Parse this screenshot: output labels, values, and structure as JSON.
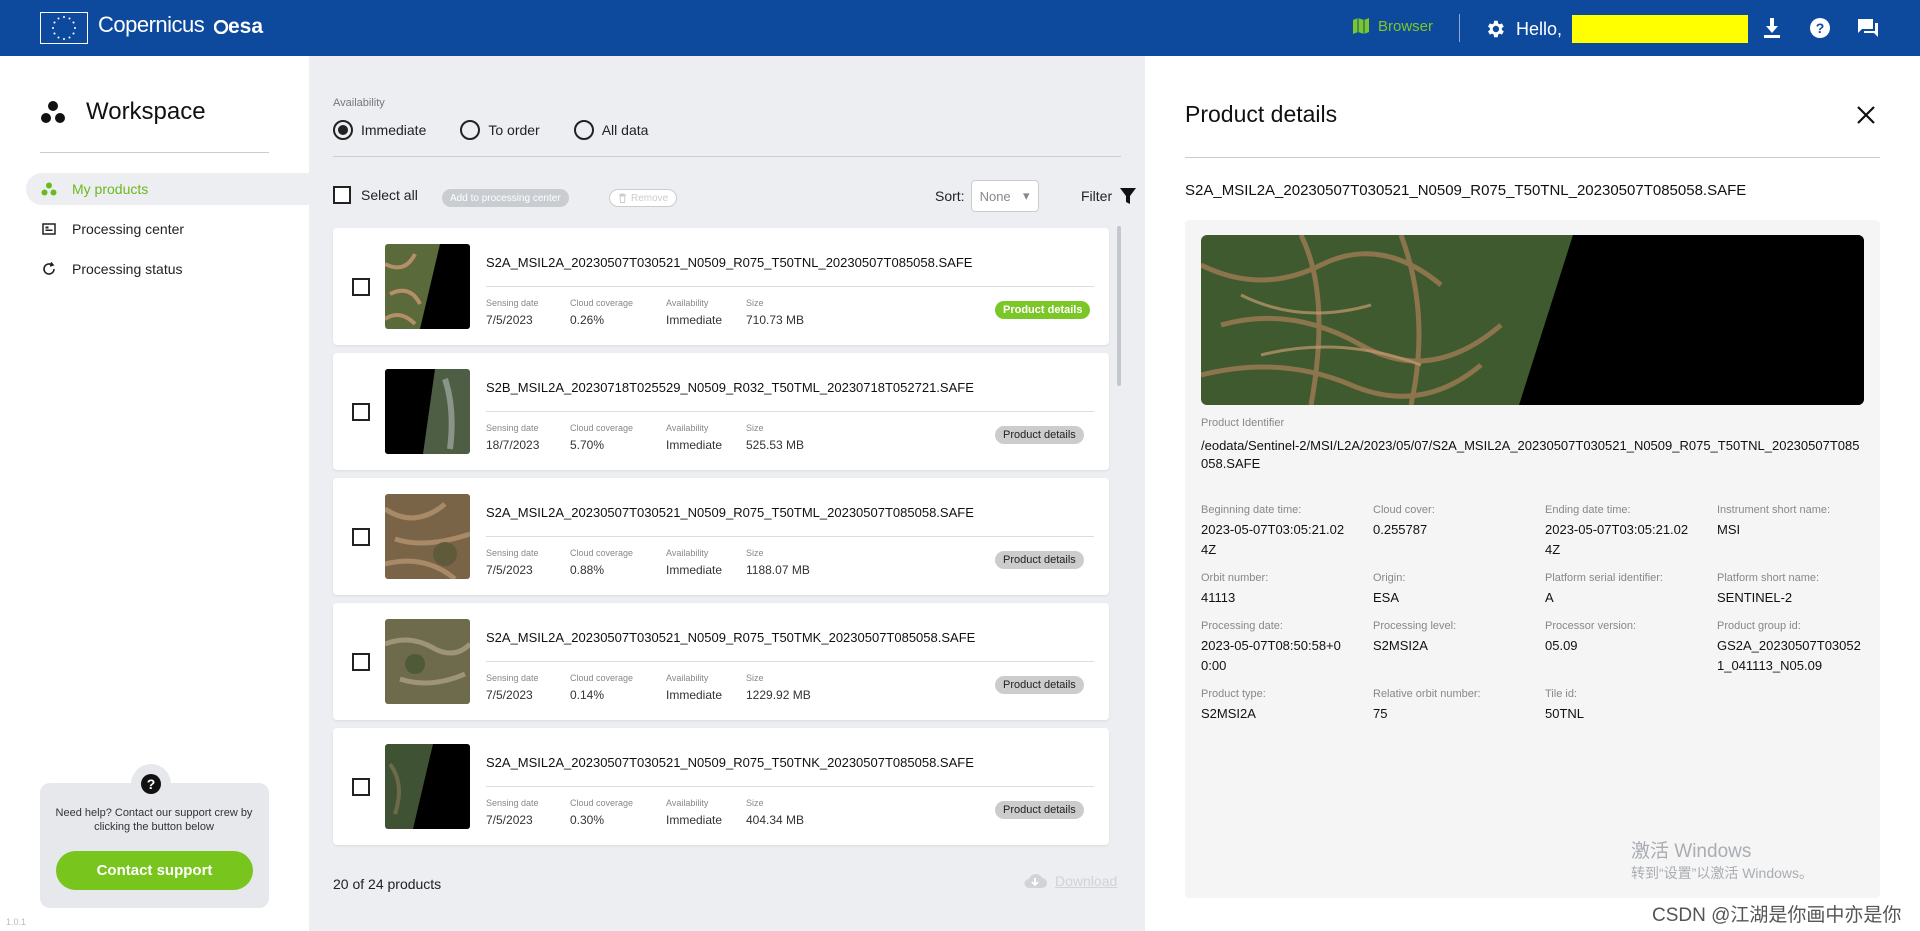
{
  "header": {
    "brand": "Copernicus",
    "agency": "esa",
    "browser_label": "Browser",
    "greeting": "Hello,",
    "icons": [
      "settings-icon",
      "download-icon",
      "help-icon",
      "chat-icon"
    ]
  },
  "sidebar": {
    "title": "Workspace",
    "items": [
      {
        "label": "My products",
        "active": true
      },
      {
        "label": "Processing center",
        "active": false
      },
      {
        "label": "Processing status",
        "active": false
      }
    ],
    "help_text": "Need help? Contact our support crew by clicking the button below",
    "contact_label": "Contact support",
    "version": "1.0.1"
  },
  "main": {
    "availability_label": "Availability",
    "radios": [
      {
        "label": "Immediate",
        "selected": true
      },
      {
        "label": "To order",
        "selected": false
      },
      {
        "label": "All data",
        "selected": false
      }
    ],
    "select_all": "Select all",
    "add_label": "Add to processing center",
    "remove_label": "Remove",
    "sort_label": "Sort:",
    "sort_value": "None",
    "filter_label": "Filter",
    "meta_labels": {
      "sensing": "Sensing date",
      "cloud": "Cloud coverage",
      "availability": "Availability",
      "size": "Size"
    },
    "details_label": "Product details",
    "products": [
      {
        "name": "S2A_MSIL2A_20230507T030521_N0509_R075_T50TNL_20230507T085058.SAFE",
        "sensing": "7/5/2023",
        "cloud": "0.26%",
        "availability": "Immediate",
        "size": "710.73 MB",
        "active": true
      },
      {
        "name": "S2B_MSIL2A_20230718T025529_N0509_R032_T50TML_20230718T052721.SAFE",
        "sensing": "18/7/2023",
        "cloud": "5.70%",
        "availability": "Immediate",
        "size": "525.53 MB",
        "active": false
      },
      {
        "name": "S2A_MSIL2A_20230507T030521_N0509_R075_T50TML_20230507T085058.SAFE",
        "sensing": "7/5/2023",
        "cloud": "0.88%",
        "availability": "Immediate",
        "size": "1188.07 MB",
        "active": false
      },
      {
        "name": "S2A_MSIL2A_20230507T030521_N0509_R075_T50TMK_20230507T085058.SAFE",
        "sensing": "7/5/2023",
        "cloud": "0.14%",
        "availability": "Immediate",
        "size": "1229.92 MB",
        "active": false
      },
      {
        "name": "S2A_MSIL2A_20230507T030521_N0509_R075_T50TNK_20230507T085058.SAFE",
        "sensing": "7/5/2023",
        "cloud": "0.30%",
        "availability": "Immediate",
        "size": "404.34 MB",
        "active": false
      }
    ],
    "count": "20 of 24 products",
    "download_label": "Download"
  },
  "details": {
    "title": "Product details",
    "name": "S2A_MSIL2A_20230507T030521_N0509_R075_T50TNL_20230507T085058.SAFE",
    "pid_label": "Product Identifier",
    "pid_value": "/eodata/Sentinel-2/MSI/L2A/2023/05/07/S2A_MSIL2A_20230507T030521_N0509_R075_T50TNL_20230507T085058.SAFE",
    "fields": [
      {
        "label": "Beginning date time:",
        "value": "2023-05-07T03:05:21.024Z"
      },
      {
        "label": "Cloud cover:",
        "value": "0.255787"
      },
      {
        "label": "Ending date time:",
        "value": "2023-05-07T03:05:21.024Z"
      },
      {
        "label": "Instrument short name:",
        "value": "MSI"
      },
      {
        "label": "Orbit number:",
        "value": "41113"
      },
      {
        "label": "Origin:",
        "value": "ESA"
      },
      {
        "label": "Platform serial identifier:",
        "value": "A"
      },
      {
        "label": "Platform short name:",
        "value": "SENTINEL-2"
      },
      {
        "label": "Processing date:",
        "value": "2023-05-07T08:50:58+00:00"
      },
      {
        "label": "Processing level:",
        "value": "S2MSI2A"
      },
      {
        "label": "Processor version:",
        "value": "05.09"
      },
      {
        "label": "Product group id:",
        "value": "GS2A_20230507T030521_041113_N05.09"
      },
      {
        "label": "Product type:",
        "value": "S2MSI2A"
      },
      {
        "label": "Relative orbit number:",
        "value": "75"
      },
      {
        "label": "Tile id:",
        "value": "50TNL"
      }
    ]
  },
  "overlay": {
    "watermark_line1": "激活 Windows",
    "watermark_line2": "转到“设置”以激活 Windows。",
    "credit": "CSDN @江湖是你画中亦是你"
  },
  "colors": {
    "header_bg": "#0d4a9e",
    "accent": "#7cc728",
    "panel_bg": "#eceef1"
  }
}
